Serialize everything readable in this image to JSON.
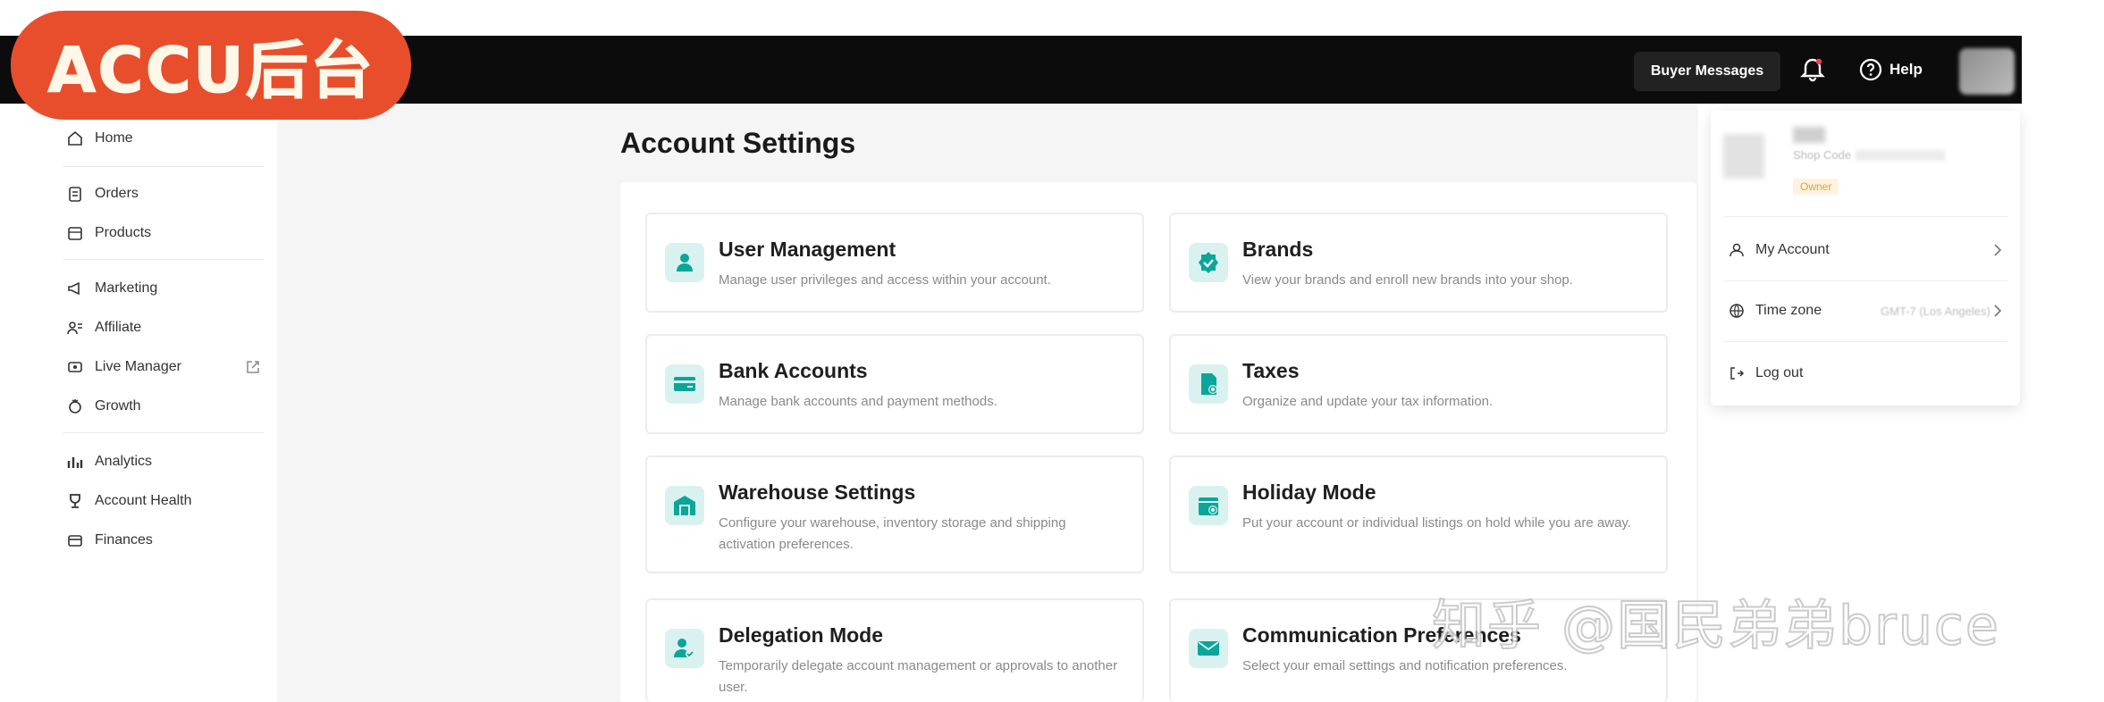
{
  "badge": {
    "text": "ACCU后台"
  },
  "header": {
    "buyer_messages": "Buyer Messages",
    "bell_icon": "bell-icon",
    "help_label": "Help"
  },
  "sidebar": {
    "items": [
      {
        "label": "Home",
        "icon": "home-icon"
      },
      {
        "label": "Orders",
        "icon": "clipboard-icon"
      },
      {
        "label": "Products",
        "icon": "box-icon"
      },
      {
        "label": "Marketing",
        "icon": "megaphone-icon"
      },
      {
        "label": "Affiliate",
        "icon": "users-icon"
      },
      {
        "label": "Live Manager",
        "icon": "live-icon"
      },
      {
        "label": "Growth",
        "icon": "growth-icon"
      },
      {
        "label": "Analytics",
        "icon": "chart-icon"
      },
      {
        "label": "Account Health",
        "icon": "trophy-icon"
      },
      {
        "label": "Finances",
        "icon": "wallet-icon"
      }
    ]
  },
  "main": {
    "title": "Account Settings",
    "cards": [
      {
        "title": "User Management",
        "desc": "Manage user privileges and access within your account.",
        "icon": "user-icon"
      },
      {
        "title": "Brands",
        "desc": "View your brands and enroll new brands into your shop.",
        "icon": "badge-check-icon"
      },
      {
        "title": "Bank Accounts",
        "desc": "Manage bank accounts and payment methods.",
        "icon": "card-icon"
      },
      {
        "title": "Taxes",
        "desc": "Organize and update your tax information.",
        "icon": "tax-doc-icon"
      },
      {
        "title": "Warehouse Settings",
        "desc": "Configure your warehouse, inventory storage and shipping activation preferences.",
        "icon": "warehouse-icon"
      },
      {
        "title": "Holiday Mode",
        "desc": "Put your account or individual listings on hold while you are away.",
        "icon": "calendar-icon"
      },
      {
        "title": "Delegation Mode",
        "desc": "Temporarily delegate account management or approvals to another user.",
        "icon": "delegate-user-icon"
      },
      {
        "title": "Communication Preferences",
        "desc": "Select your email settings and notification preferences.",
        "icon": "mail-icon"
      }
    ]
  },
  "dropdown": {
    "shop_code_label": "Shop Code",
    "owner_badge": "Owner",
    "my_account": "My Account",
    "time_zone": "Time zone",
    "time_zone_value": "GMT-7 (Los Angeles)",
    "log_out": "Log out"
  },
  "watermark": "知乎 @国民弟弟bruce",
  "colors": {
    "accent": "#0aa59b",
    "topbar": "#0c0c0c",
    "badge": "#e94e2c"
  }
}
